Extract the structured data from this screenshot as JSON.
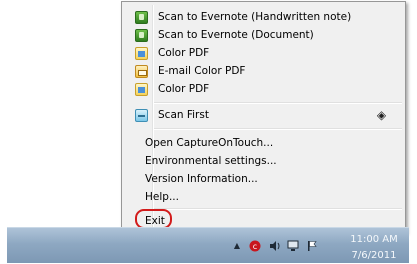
{
  "menu": {
    "items": [
      {
        "label": "Scan to Evernote (Handwritten note)",
        "icon": "evernote-icon"
      },
      {
        "label": "Scan to Evernote (Document)",
        "icon": "evernote-icon"
      },
      {
        "label": "Color PDF",
        "icon": "pdf-icon"
      },
      {
        "label": "E-mail Color PDF",
        "icon": "email-pdf-icon"
      },
      {
        "label": "Color PDF",
        "icon": "pdf-icon"
      }
    ],
    "scan_first": {
      "label": "Scan First",
      "icon": "scan-icon",
      "shortcut_icon": "diamond-icon"
    },
    "settings": [
      {
        "label": "Open CaptureOnTouch..."
      },
      {
        "label": "Environmental settings..."
      },
      {
        "label": "Version Information..."
      },
      {
        "label": "Help..."
      }
    ],
    "exit": {
      "label": "Exit",
      "highlight_color": "#d21b1b"
    }
  },
  "taskbar": {
    "time": "11:00 AM",
    "date": "7/6/2011",
    "tray_icons": [
      "show-hidden-icons-arrow",
      "captureontouch-icon",
      "volume-icon",
      "network-icon",
      "action-center-flag-icon"
    ]
  }
}
